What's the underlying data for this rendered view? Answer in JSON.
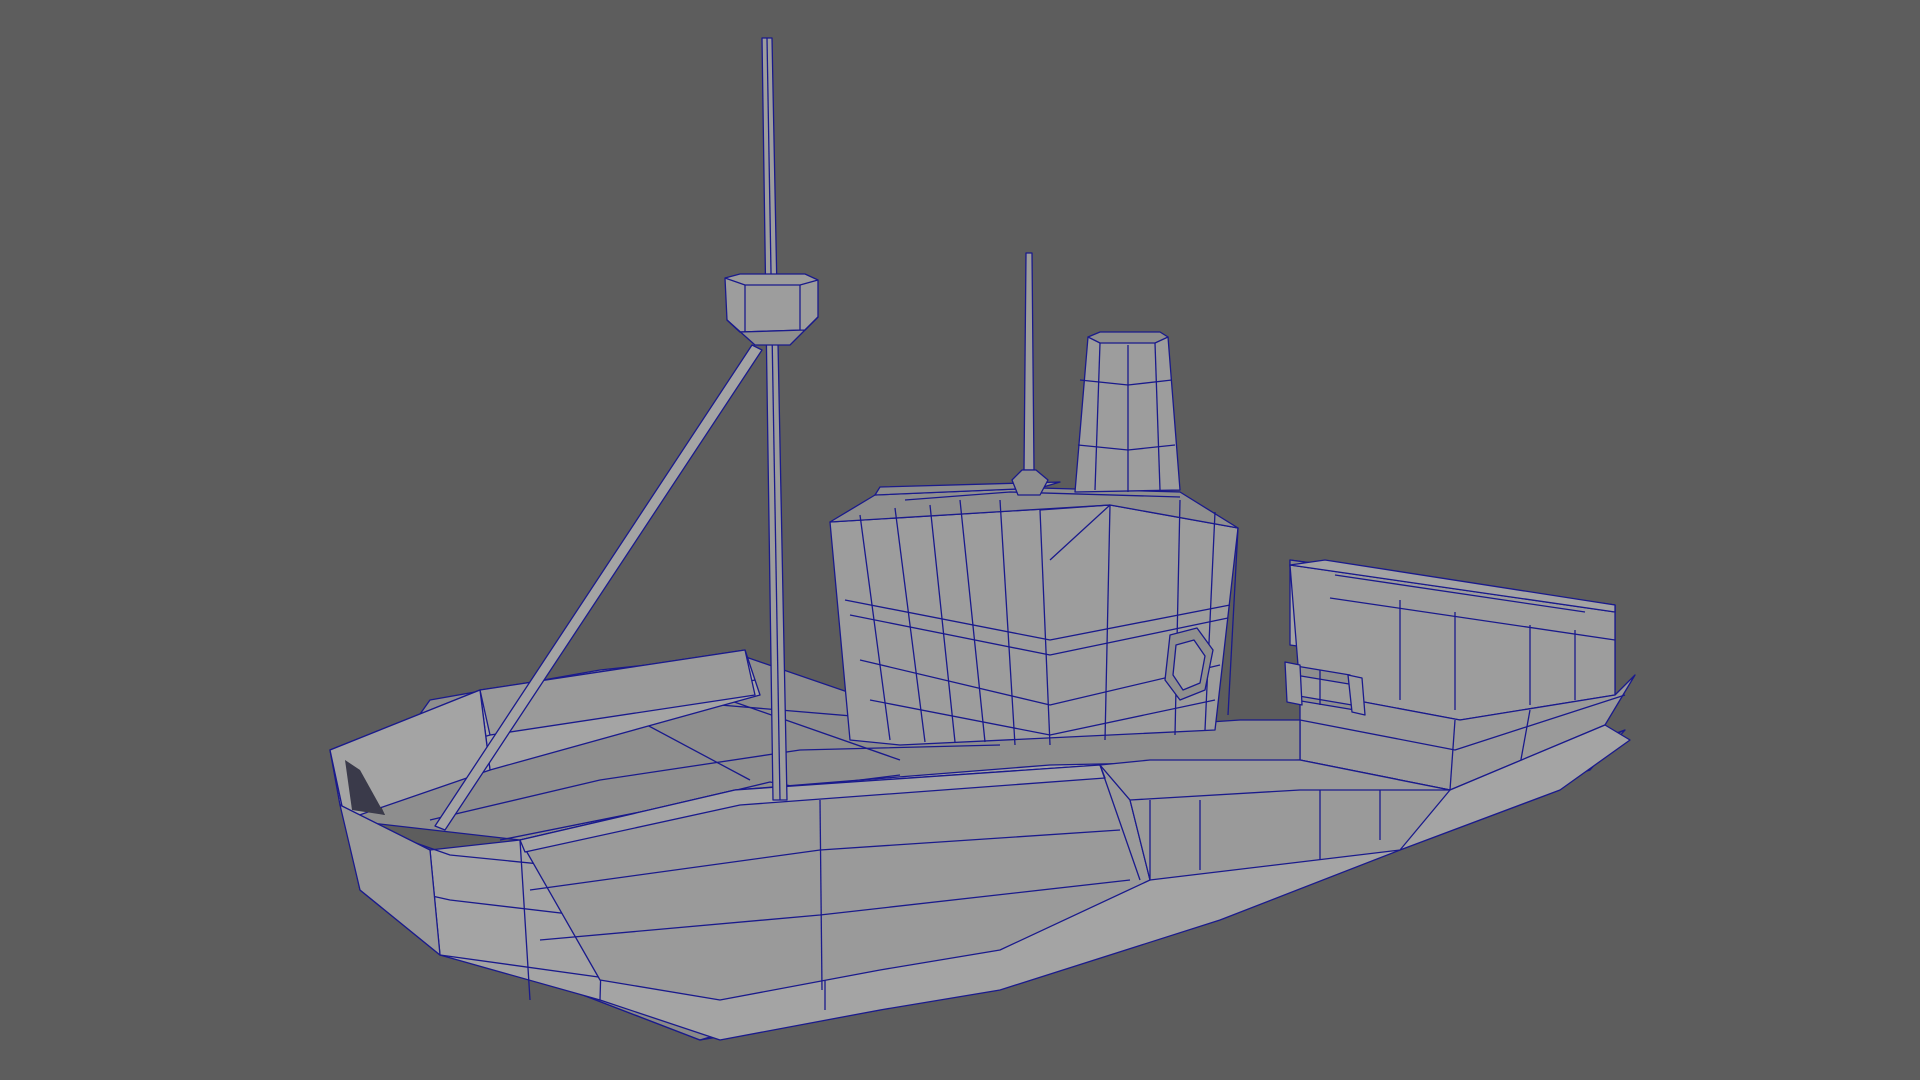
{
  "viewport": {
    "background_color": "#5d5d5d",
    "mesh_color": "#9a9a9a",
    "wireframe_color": "#1a1a8c",
    "display_mode": "wireframe-on-shaded"
  },
  "scene": {
    "objects": [
      "hull",
      "deck",
      "mast",
      "crows-nest",
      "stay-rope",
      "cabin",
      "funnel",
      "antenna",
      "porthole",
      "winch",
      "cargo-box"
    ]
  }
}
